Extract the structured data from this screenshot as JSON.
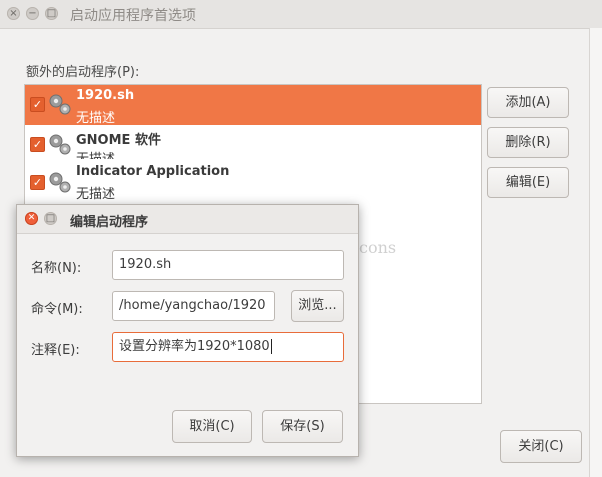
{
  "window": {
    "title": "启动应用程序首选项",
    "extra_label": "额外的启动程序(P):",
    "buttons": {
      "add": "添加(A)",
      "remove": "删除(R)",
      "edit": "编辑(E)",
      "close": "关闭(C)"
    }
  },
  "startup_programs": [
    {
      "name": "1920.sh",
      "description": "无描述",
      "enabled": true,
      "selected": true
    },
    {
      "name": "GNOME 软件",
      "description": "无描述",
      "enabled": true,
      "selected": false
    },
    {
      "name": "Indicator Application",
      "description": "无描述",
      "enabled": true,
      "selected": false
    }
  ],
  "watermark": "http://blog.csdn.net/chincons",
  "dialog": {
    "title": "编辑启动程序",
    "name_label": "名称(N):",
    "name_value": "1920.sh",
    "command_label": "命令(M):",
    "command_value": "/home/yangchao/1920",
    "browse_label": "浏览...",
    "comment_label": "注释(E):",
    "comment_value": "设置分辨率为1920*1080",
    "cancel_label": "取消(C)",
    "save_label": "保存(S)"
  },
  "colors": {
    "selection": "#f07746",
    "checkbox": "#e4602e",
    "focus": "#e86c3a"
  }
}
